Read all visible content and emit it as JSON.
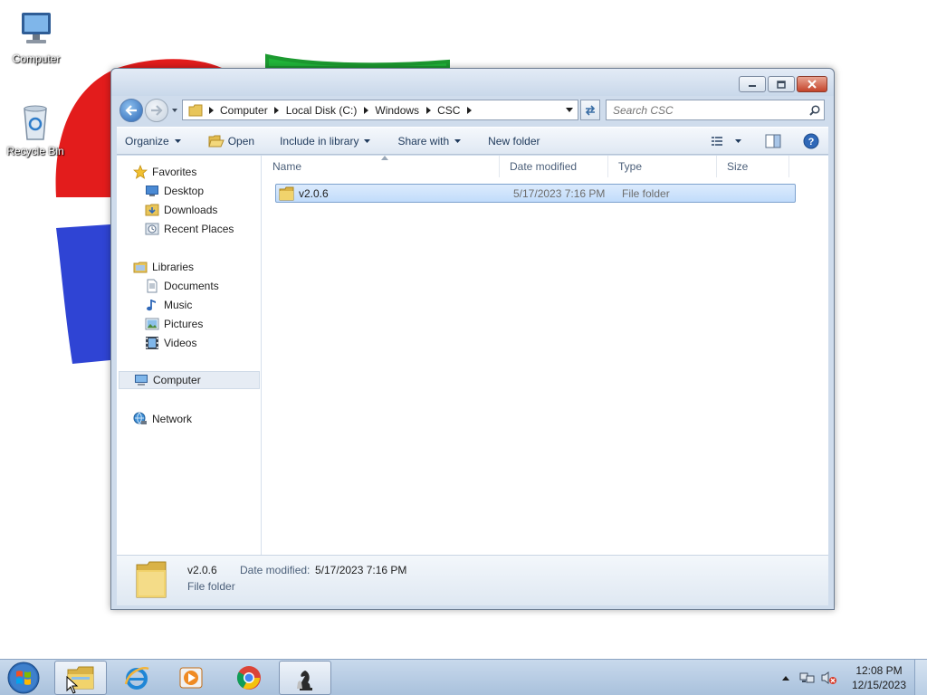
{
  "desktop": {
    "icons": [
      {
        "label": "Computer",
        "icon": "computer-icon"
      },
      {
        "label": "Recycle Bin",
        "icon": "recycle-bin-icon"
      }
    ]
  },
  "window": {
    "caption": {
      "minimize": "minimize-icon",
      "maximize": "maximize-icon",
      "close": "close-icon"
    },
    "address": {
      "crumbs": [
        "Computer",
        "Local Disk (C:)",
        "Windows",
        "CSC"
      ]
    },
    "search": {
      "placeholder": "Search CSC"
    },
    "toolbar": {
      "organize": "Organize",
      "open": "Open",
      "include_in_library": "Include in library",
      "share_with": "Share with",
      "new_folder": "New folder"
    },
    "navpane": {
      "favorites": {
        "label": "Favorites",
        "items": [
          "Desktop",
          "Downloads",
          "Recent Places"
        ]
      },
      "libraries": {
        "label": "Libraries",
        "items": [
          "Documents",
          "Music",
          "Pictures",
          "Videos"
        ]
      },
      "computer": "Computer",
      "network": "Network"
    },
    "columns": [
      "Name",
      "Date modified",
      "Type",
      "Size"
    ],
    "files": [
      {
        "name": "v2.0.6",
        "date_modified": "5/17/2023 7:16 PM",
        "type": "File folder",
        "size": ""
      }
    ],
    "details": {
      "name": "v2.0.6",
      "type": "File folder",
      "date_modified_label": "Date modified:",
      "date_modified": "5/17/2023 7:16 PM"
    }
  },
  "taskbar": {
    "pinned": [
      "windows-explorer",
      "internet-explorer",
      "media-player",
      "chrome",
      "chess-titans"
    ],
    "clock": {
      "time": "12:08 PM",
      "date": "12/15/2023"
    }
  },
  "colors": {
    "accent": "#2a66b5",
    "selection": "#c1dcfb",
    "taskbar": "#b4c9e2"
  }
}
